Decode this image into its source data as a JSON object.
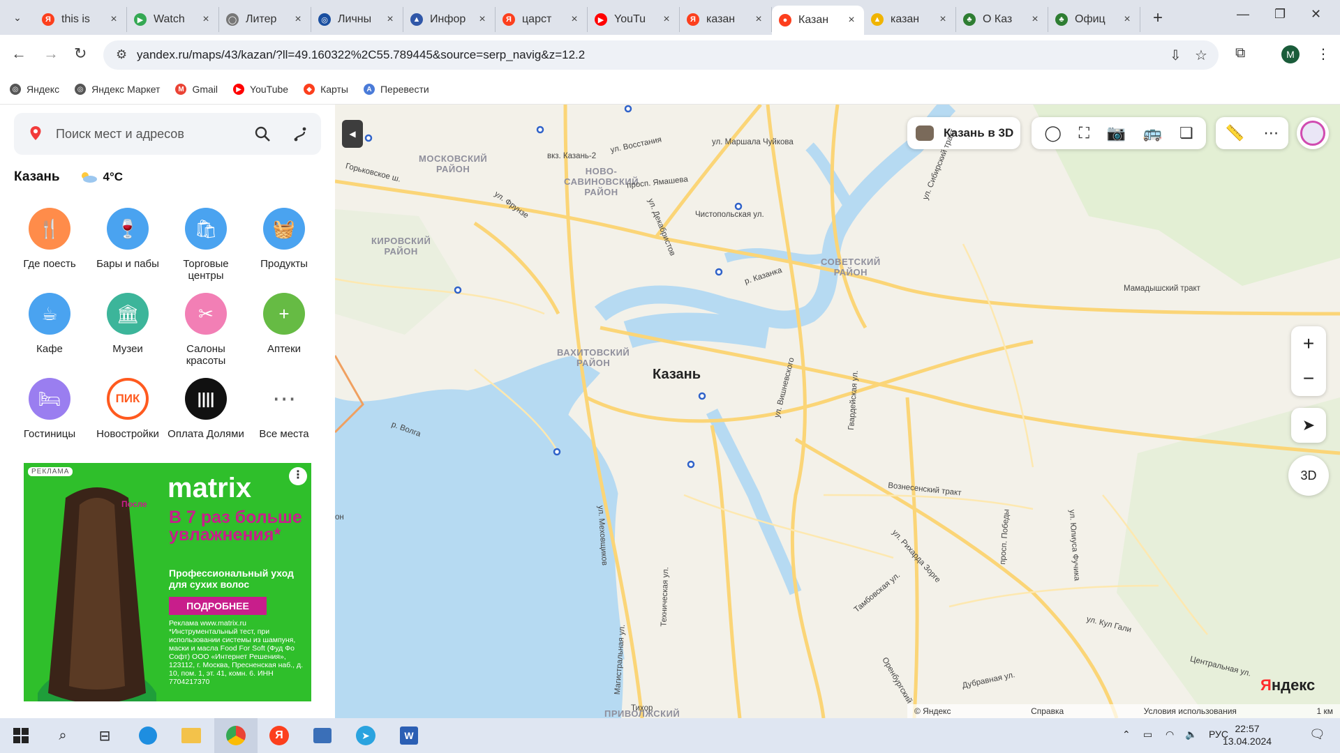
{
  "browser": {
    "tabs": [
      {
        "label": "this is",
        "color": "#fc3f1d",
        "glyph": "Я"
      },
      {
        "label": "Watch",
        "color": "#34a853",
        "glyph": "▶"
      },
      {
        "label": "Литер",
        "color": "#777777",
        "glyph": "◯"
      },
      {
        "label": "Личны",
        "color": "#1a4fa0",
        "glyph": "◎"
      },
      {
        "label": "Инфор",
        "color": "#3057a8",
        "glyph": "▲"
      },
      {
        "label": "царст",
        "color": "#fc3f1d",
        "glyph": "Я"
      },
      {
        "label": "YouTu",
        "color": "#ff0000",
        "glyph": "▶"
      },
      {
        "label": "казан",
        "color": "#fc3f1d",
        "glyph": "Я"
      },
      {
        "label": "Казан",
        "color": "#fc3f1d",
        "glyph": "●",
        "active": true
      },
      {
        "label": "казан",
        "color": "#f0b400",
        "glyph": "▲"
      },
      {
        "label": "О Каз",
        "color": "#2e7d32",
        "glyph": "♣"
      },
      {
        "label": "Офиц",
        "color": "#2e7d32",
        "glyph": "♣"
      }
    ],
    "url": "yandex.ru/maps/43/kazan/?ll=49.160322%2C55.789445&source=serp_navig&z=12.2",
    "profile_initial": "M",
    "bookmarks": [
      {
        "label": "Яндекс",
        "color": "#555555",
        "glyph": "◎"
      },
      {
        "label": "Яндекс Маркет",
        "color": "#555555",
        "glyph": "◎"
      },
      {
        "label": "Gmail",
        "color": "#ea4335",
        "glyph": "M"
      },
      {
        "label": "YouTube",
        "color": "#ff0000",
        "glyph": "▶"
      },
      {
        "label": "Карты",
        "color": "#fc3f1d",
        "glyph": "◆"
      },
      {
        "label": "Перевести",
        "color": "#4a7bd8",
        "glyph": "A"
      }
    ]
  },
  "sidebar": {
    "search_placeholder": "Поиск мест и адресов",
    "city": "Казань",
    "temperature": "4°C",
    "categories": [
      {
        "label": "Где поесть",
        "color": "#ff8c4a",
        "glyph": "🍴"
      },
      {
        "label": "Бары и пабы",
        "color": "#4aa3f0",
        "glyph": "🍷"
      },
      {
        "label": "Торговые центры",
        "color": "#4aa3f0",
        "glyph": "🛍"
      },
      {
        "label": "Продукты",
        "color": "#4aa3f0",
        "glyph": "🧺"
      },
      {
        "label": "Кафе",
        "color": "#4aa3f0",
        "glyph": "☕"
      },
      {
        "label": "Музеи",
        "color": "#3cb59a",
        "glyph": "🏛"
      },
      {
        "label": "Салоны красоты",
        "color": "#f27fb5",
        "glyph": "✂"
      },
      {
        "label": "Аптеки",
        "color": "#66bb44",
        "glyph": "+"
      },
      {
        "label": "Гостиницы",
        "color": "#9a7ef0",
        "glyph": "🛏"
      },
      {
        "label": "Новостройки",
        "color": "#ffffff",
        "glyph": "ПИК"
      },
      {
        "label": "Оплата Долями",
        "color": "#111111",
        "glyph": "||||"
      },
      {
        "label": "Все места",
        "color": "#ffffff",
        "glyph": "⋯"
      }
    ],
    "ad": {
      "tag": "РЕКЛАМА",
      "after_label": "После",
      "logo": "matrix",
      "headline": "В 7 раз больше увлажнения*",
      "sub": "Профессиональный уход для сухих волос",
      "button": "ПОДРОБНЕЕ",
      "legal": "Реклама www.matrix.ru *Инструментальный тест, при использовании системы из шампуня, маски и масла Food For Soft (Фуд Фо Софт) ООО «Интернет Решения», 123112, г. Москва, Пресненская наб., д. 10, пом. 1, эт. 41, комн. 6. ИНН 7704217370"
    }
  },
  "map": {
    "btn_3d": "Казань в 3D",
    "compass_label": "3D",
    "city_label": "Казань",
    "districts": [
      {
        "label": "МОСКОВСКИЙ\nРАЙОН"
      },
      {
        "label": "НОВО-\nСАВИНОВСКИЙ\nРАЙОН"
      },
      {
        "label": "КИРОВСКИЙ\nРАЙОН"
      },
      {
        "label": "СОВЕТСКИЙ\nРАЙОН"
      },
      {
        "label": "ВАХИТОВСКИЙ\nРАЙОН"
      },
      {
        "label": "ПРИВОЛЖСКИЙ"
      }
    ],
    "streets": [
      "вкз. Казань-2",
      "ул. Восстания",
      "ул. Маршала Чуйкова",
      "Горьковское ш.",
      "просп. Ямашева",
      "ул. Фрунзе",
      "Чистопольская ул.",
      "ул. Декабристов",
      "р. Казанка",
      "Мамадышский тракт",
      "р. Волга",
      "ул. Вишневского",
      "Гвардейская ул.",
      "Вознесенский тракт",
      "ул. Меховщиков",
      "Техническая ул.",
      "ул. Рихарда Зорге",
      "просп. Победы",
      "ул. Юлиуса Фучика",
      "ул. Кул Гали",
      "Магистральная ул.",
      "Тамбовская ул.",
      "Оренбургский",
      "Дубравная ул.",
      "Центральная ул.",
      "ул. Сибирский тракт",
      "Тихор",
      "он"
    ],
    "logo": "Яндекс",
    "footer": {
      "copyright": "© Яндекс",
      "help": "Справка",
      "terms": "Условия использования",
      "scale": "1 км"
    }
  },
  "taskbar": {
    "lang": "РУС",
    "time": "22:57",
    "date": "13.04.2024"
  }
}
